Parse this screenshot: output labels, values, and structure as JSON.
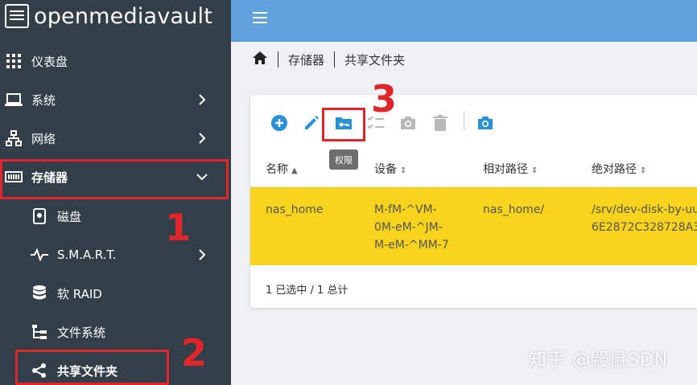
{
  "app": {
    "title": "openmediavault"
  },
  "sidebar": {
    "items": [
      {
        "label": "仪表盘",
        "icon": "dashboard-grid-icon"
      },
      {
        "label": "系统",
        "icon": "laptop-icon"
      },
      {
        "label": "网络",
        "icon": "network-icon"
      },
      {
        "label": "存储器",
        "icon": "storage-icon"
      },
      {
        "label": "磁盘",
        "icon": "disk-icon"
      },
      {
        "label": "S.M.A.R.T.",
        "icon": "pulse-icon"
      },
      {
        "label": "软 RAID",
        "icon": "database-icon"
      },
      {
        "label": "文件系统",
        "icon": "file-tree-icon"
      },
      {
        "label": "共享文件夹",
        "icon": "share-icon"
      }
    ]
  },
  "breadcrumb": {
    "items": [
      "存储器",
      "共享文件夹"
    ]
  },
  "toolbar": {
    "tooltip": "权限"
  },
  "table": {
    "headers": [
      "名称",
      "设备",
      "相对路径",
      "绝对路径"
    ],
    "row": {
      "name": "nas_home",
      "device": [
        "M-fM-^VM-",
        "0M-eM-^JM-",
        "M-eM-^MM-7"
      ],
      "relpath": "nas_home/",
      "abspath": [
        "/srv/dev-disk-by-uu",
        "6E2872C328728A3"
      ]
    },
    "footer": "1 已选中 / 1 总计"
  },
  "annotations": {
    "n1": "1",
    "n2": "2",
    "n3": "3"
  },
  "watermark": "知乎 @鼹鼠SDN",
  "colors": {
    "sidebar": "#323e48",
    "topbar": "#5fa2dd",
    "accent": "#2a90d8",
    "selected_row": "#f8d31b",
    "annotation": "#e0262a"
  }
}
